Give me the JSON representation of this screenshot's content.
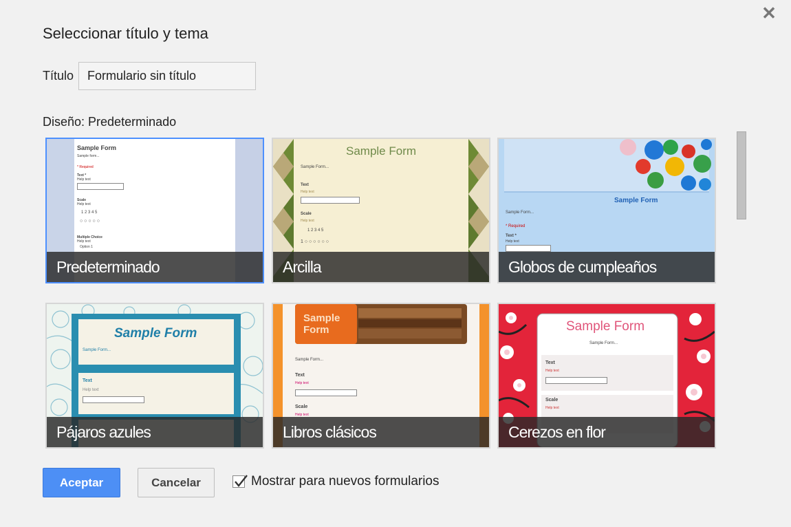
{
  "dialog": {
    "title": "Seleccionar título y tema",
    "close_icon": "close-icon"
  },
  "title_field": {
    "label": "Título",
    "value": "Formulario sin título"
  },
  "design": {
    "label": "Diseño: Predeterminado"
  },
  "themes": [
    {
      "name": "Predeterminado",
      "selected": true
    },
    {
      "name": "Arcilla",
      "selected": false
    },
    {
      "name": "Globos de cumpleaños",
      "selected": false
    },
    {
      "name": "Pájaros azules",
      "selected": false
    },
    {
      "name": "Libros clásicos",
      "selected": false
    },
    {
      "name": "Cerezos en flor",
      "selected": false
    }
  ],
  "previews": {
    "sample_form": "Sample Form",
    "sample_form_short": "Sample form...",
    "sample_form_dots": "Sample Form...",
    "required": "* Required",
    "text": "Text",
    "text_req": "Text *",
    "help_text": "Help text",
    "scale": "Scale",
    "multiple_choice": "Multiple Choice",
    "option1": "Option 1",
    "scale_numbers": "1   2   3   4   5",
    "scale_circles": "○  ○  ○  ○  ○",
    "scale_circles6": "1 ○  ○  ○  ○  ○  ○"
  },
  "buttons": {
    "accept": "Aceptar",
    "cancel": "Cancelar"
  },
  "checkbox": {
    "label": "Mostrar para nuevos formularios",
    "checked": true
  },
  "colors": {
    "accent": "#4d90fe",
    "accept_bg": "#4d8ff5",
    "clay_bg": "#f6efd3",
    "clay_diamond": "#5e7a2f",
    "balloon_sky": "#b8d7f3",
    "birds_teal": "#2a8eb0",
    "books_orange": "#f4922b",
    "cherry_red": "#e3243a"
  }
}
